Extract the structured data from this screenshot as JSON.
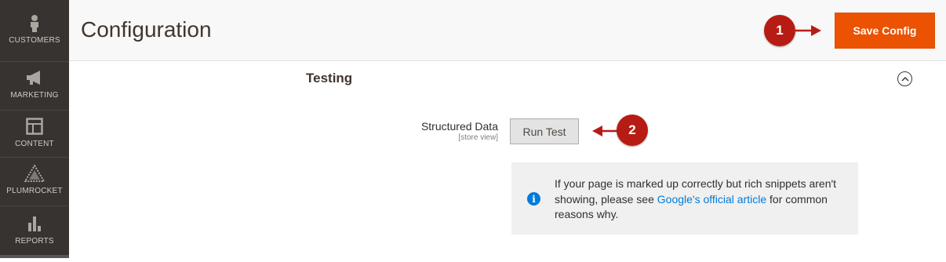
{
  "sidebar": {
    "items": [
      {
        "label": "CUSTOMERS",
        "icon": "person-icon"
      },
      {
        "label": "MARKETING",
        "icon": "megaphone-icon"
      },
      {
        "label": "CONTENT",
        "icon": "layout-icon"
      },
      {
        "label": "PLUMROCKET",
        "icon": "plumrocket-logo-icon"
      },
      {
        "label": "REPORTS",
        "icon": "bar-chart-icon"
      }
    ]
  },
  "header": {
    "title": "Configuration",
    "save_label": "Save Config"
  },
  "callouts": {
    "one": "1",
    "two": "2"
  },
  "section": {
    "title": "Testing",
    "field_label": "Structured Data",
    "field_scope": "[store view]",
    "run_label": "Run Test"
  },
  "note": {
    "text_before": "If your page is marked up correctly but rich snippets aren't showing, please see ",
    "link_text": "Google's official article",
    "text_after": " for common reasons why."
  },
  "colors": {
    "accent": "#eb5202",
    "sidebar": "#373330",
    "callout": "#b71c14",
    "link": "#007bdb"
  }
}
